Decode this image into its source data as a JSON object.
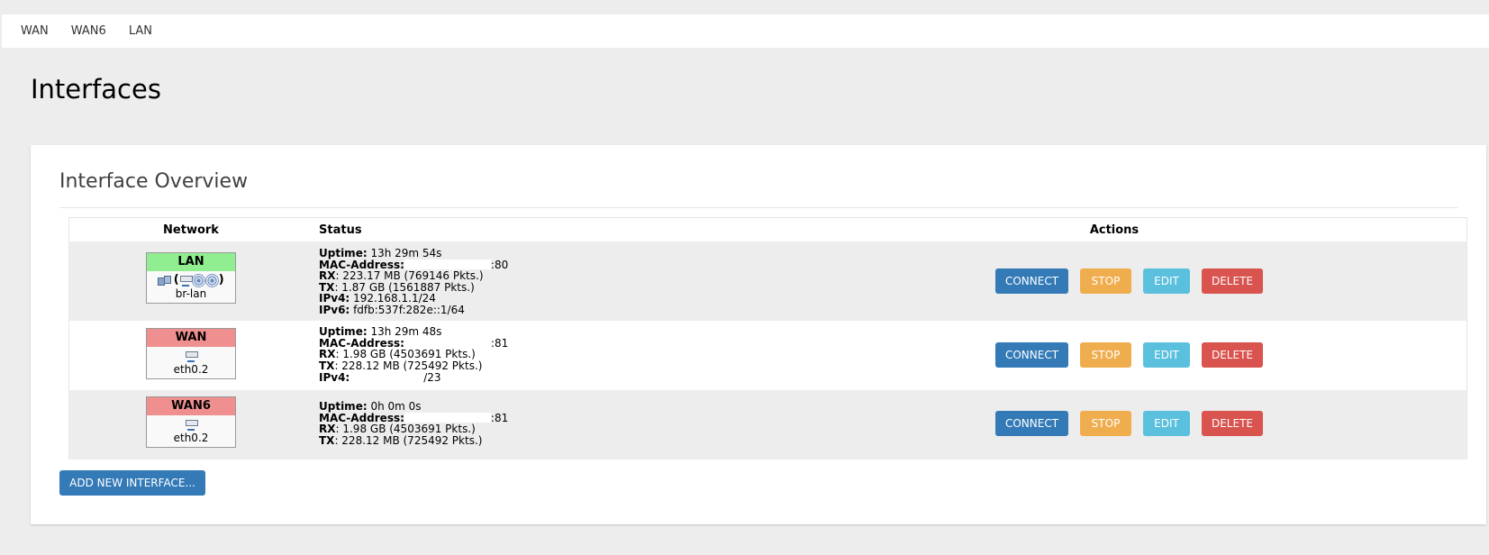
{
  "topnav": {
    "items": [
      "WAN",
      "WAN6",
      "LAN"
    ]
  },
  "page": {
    "title": "Interfaces"
  },
  "panel": {
    "title": "Interface Overview",
    "columns": {
      "network": "Network",
      "status": "Status",
      "actions": "Actions"
    },
    "rows": [
      {
        "name": "LAN",
        "state": "up",
        "state_color": "#90ee90",
        "icons": [
          "bridge-icon",
          "ethernet-icon",
          "wifi-icon",
          "wifi-icon"
        ],
        "device": "br-lan",
        "status": {
          "uptime_label": "Uptime:",
          "uptime": "13h 29m 54s",
          "mac_label": "MAC-Address:",
          "mac_suffix": ":80",
          "rx_label": "RX",
          "rx": ": 223.17 MB (769146 Pkts.)",
          "tx_label": "TX",
          "tx": ": 1.87 GB (1561887 Pkts.)",
          "ipv4_label": "IPv4:",
          "ipv4": "192.168.1.1/24",
          "ipv6_label": "IPv6:",
          "ipv6": "fdfb:537f:282e::1/64"
        }
      },
      {
        "name": "WAN",
        "state": "down",
        "state_color": "#f08f8f",
        "icons": [
          "ethernet-icon"
        ],
        "device": "eth0.2",
        "status": {
          "uptime_label": "Uptime:",
          "uptime": "13h 29m 48s",
          "mac_label": "MAC-Address:",
          "mac_suffix": ":81",
          "rx_label": "RX",
          "rx": ": 1.98 GB (4503691 Pkts.)",
          "tx_label": "TX",
          "tx": ": 228.12 MB (725492 Pkts.)",
          "ipv4_label": "IPv4:",
          "ipv4_suffix": "/23"
        }
      },
      {
        "name": "WAN6",
        "state": "down",
        "state_color": "#f08f8f",
        "icons": [
          "ethernet-icon"
        ],
        "device": "eth0.2",
        "status": {
          "uptime_label": "Uptime:",
          "uptime": "0h 0m 0s",
          "mac_label": "MAC-Address:",
          "mac_suffix": ":81",
          "rx_label": "RX",
          "rx": ": 1.98 GB (4503691 Pkts.)",
          "tx_label": "TX",
          "tx": ": 228.12 MB (725492 Pkts.)"
        }
      }
    ],
    "actions": {
      "connect": "CONNECT",
      "stop": "STOP",
      "edit": "EDIT",
      "delete": "DELETE"
    },
    "add_button": "ADD NEW INTERFACE..."
  },
  "colors": {
    "primary": "#337ab7",
    "warning": "#f0ad4e",
    "info": "#5bc0de",
    "danger": "#d9534f",
    "up": "#90ee90",
    "down": "#f08f8f"
  }
}
